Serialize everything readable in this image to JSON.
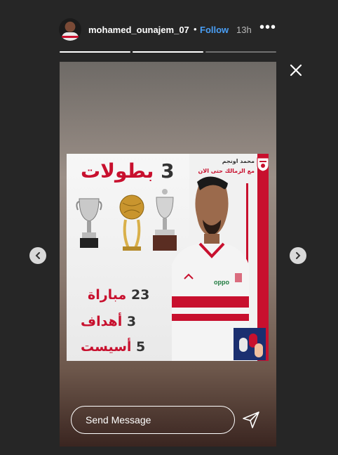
{
  "header": {
    "username": "mohamed_ounajem_07",
    "separator": "•",
    "follow_label": "Follow",
    "time": "13h",
    "more_label": "•••"
  },
  "progress": [
    1,
    1,
    0
  ],
  "story": {
    "poster": {
      "titles_count": "3",
      "titles_label": "بطولات",
      "player_name": "محمد اونجم",
      "since_label": "مع الزمالك حتى الان",
      "stats": [
        {
          "value": "23",
          "label": "مباراة"
        },
        {
          "value": "3",
          "label": "أهداف"
        },
        {
          "value": "5",
          "label": "أسيست"
        }
      ],
      "jersey_sponsor": "OPPO",
      "colors": {
        "red": "#c8102e",
        "white": "#ffffff"
      }
    }
  },
  "reply": {
    "placeholder": "Send Message"
  },
  "icons": {
    "close": "close-icon",
    "prev": "chevron-left-icon",
    "next": "chevron-right-icon",
    "send": "paper-plane-icon",
    "more": "more-horizontal-icon"
  },
  "colors": {
    "follow": "#4a9ff5",
    "background": "#262626"
  }
}
